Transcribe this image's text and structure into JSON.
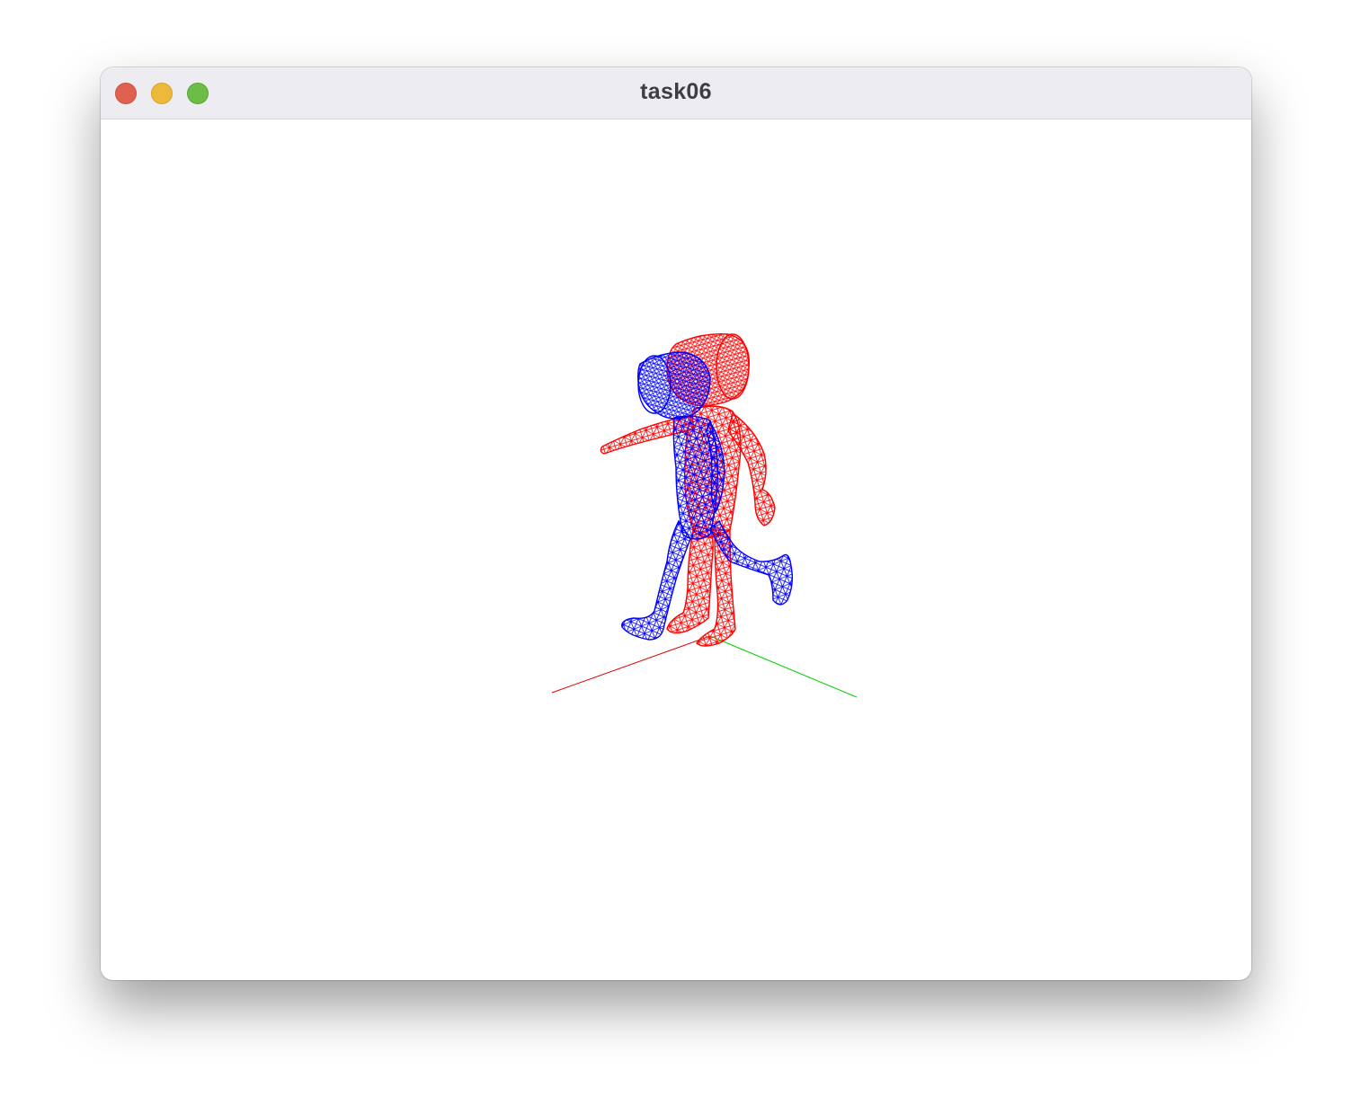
{
  "window": {
    "title": "task06",
    "buttons": {
      "close": "close-window",
      "minimize": "minimize-window",
      "maximize": "maximize-window"
    }
  },
  "scene": {
    "background": "#ffffff",
    "axis_x_color": "#e00000",
    "axis_y_color": "#00d000",
    "figure_red_color": "#ff0000",
    "figure_blue_color": "#0000ff",
    "render_mode": "wireframe"
  }
}
